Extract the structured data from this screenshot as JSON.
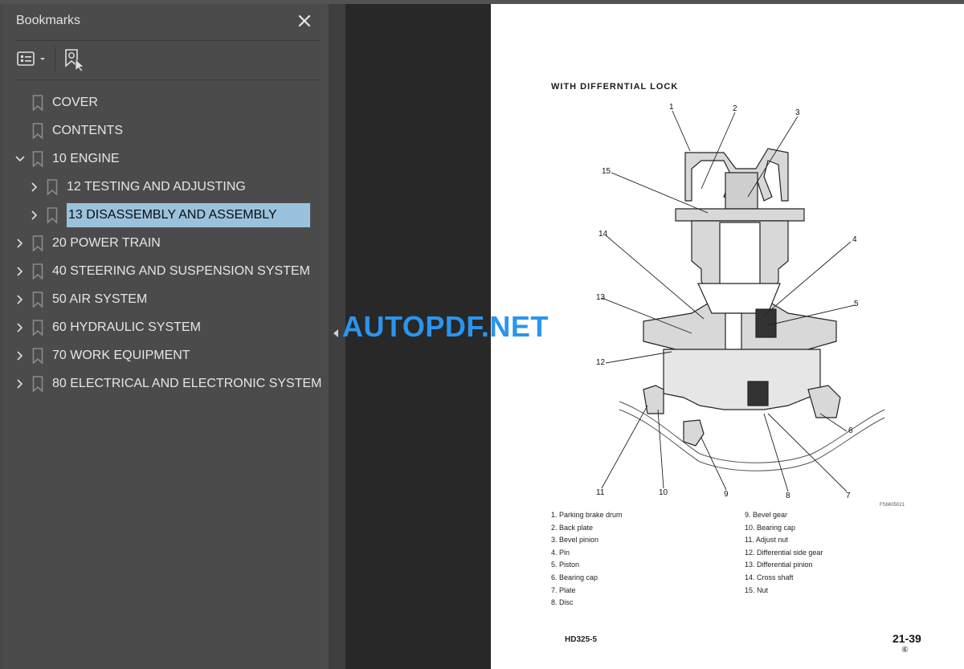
{
  "bookmarks_panel": {
    "title": "Bookmarks",
    "close_icon": "close-icon",
    "toolbar": {
      "options_icon": "list-options-icon",
      "find_icon": "find-current-bookmark-icon"
    },
    "items": [
      {
        "label": "COVER",
        "level": 0,
        "expander": "none",
        "selected": false
      },
      {
        "label": "CONTENTS",
        "level": 0,
        "expander": "none",
        "selected": false
      },
      {
        "label": "10 ENGINE",
        "level": 0,
        "expander": "expanded",
        "selected": false
      },
      {
        "label": "12 TESTING AND ADJUSTING",
        "level": 1,
        "expander": "collapsed",
        "selected": false
      },
      {
        "label": "13 DISASSEMBLY AND ASSEMBLY",
        "level": 1,
        "expander": "collapsed",
        "selected": true
      },
      {
        "label": "20 POWER TRAIN",
        "level": 0,
        "expander": "collapsed",
        "selected": false
      },
      {
        "label": "40 STEERING AND SUSPENSION SYSTEM",
        "level": 0,
        "expander": "collapsed",
        "selected": false
      },
      {
        "label": "50 AIR SYSTEM",
        "level": 0,
        "expander": "collapsed",
        "selected": false
      },
      {
        "label": "60 HYDRAULIC SYSTEM",
        "level": 0,
        "expander": "collapsed",
        "selected": false
      },
      {
        "label": "70 WORK EQUIPMENT",
        "level": 0,
        "expander": "collapsed",
        "selected": false
      },
      {
        "label": "80 ELECTRICAL AND ELECTRONIC SYSTEM",
        "level": 0,
        "expander": "collapsed",
        "selected": false
      }
    ]
  },
  "watermark": "AUTOPDF.NET",
  "document_page": {
    "heading": "WITH DIFFERNTIAL LOCK",
    "callout_numbers": [
      "1",
      "2",
      "3",
      "4",
      "5",
      "6",
      "7",
      "8",
      "9",
      "10",
      "11",
      "12",
      "13",
      "14",
      "15"
    ],
    "figure_id": "FS6605021",
    "legend_left": [
      "1.  Parking brake drum",
      "2.  Back plate",
      "3.  Bevel pinion",
      "4.  Pin",
      "5.  Piston",
      "6.  Bearing cap",
      "7.  Plate",
      "8.  Disc"
    ],
    "legend_right": [
      "9.  Bevel gear",
      "10.  Bearing cap",
      "11.  Adjust nut",
      "12.  Differential side gear",
      "13.  Differential pinion",
      "14.  Cross shaft",
      "15.  Nut"
    ],
    "footer_model": "HD325-5",
    "footer_page": "21-39",
    "footer_revision": "⑥"
  },
  "colors": {
    "panel_bg": "#4b4b4b",
    "viewer_bg": "#282828",
    "selection": "#9ac2dc",
    "watermark": "#2a95ee"
  }
}
